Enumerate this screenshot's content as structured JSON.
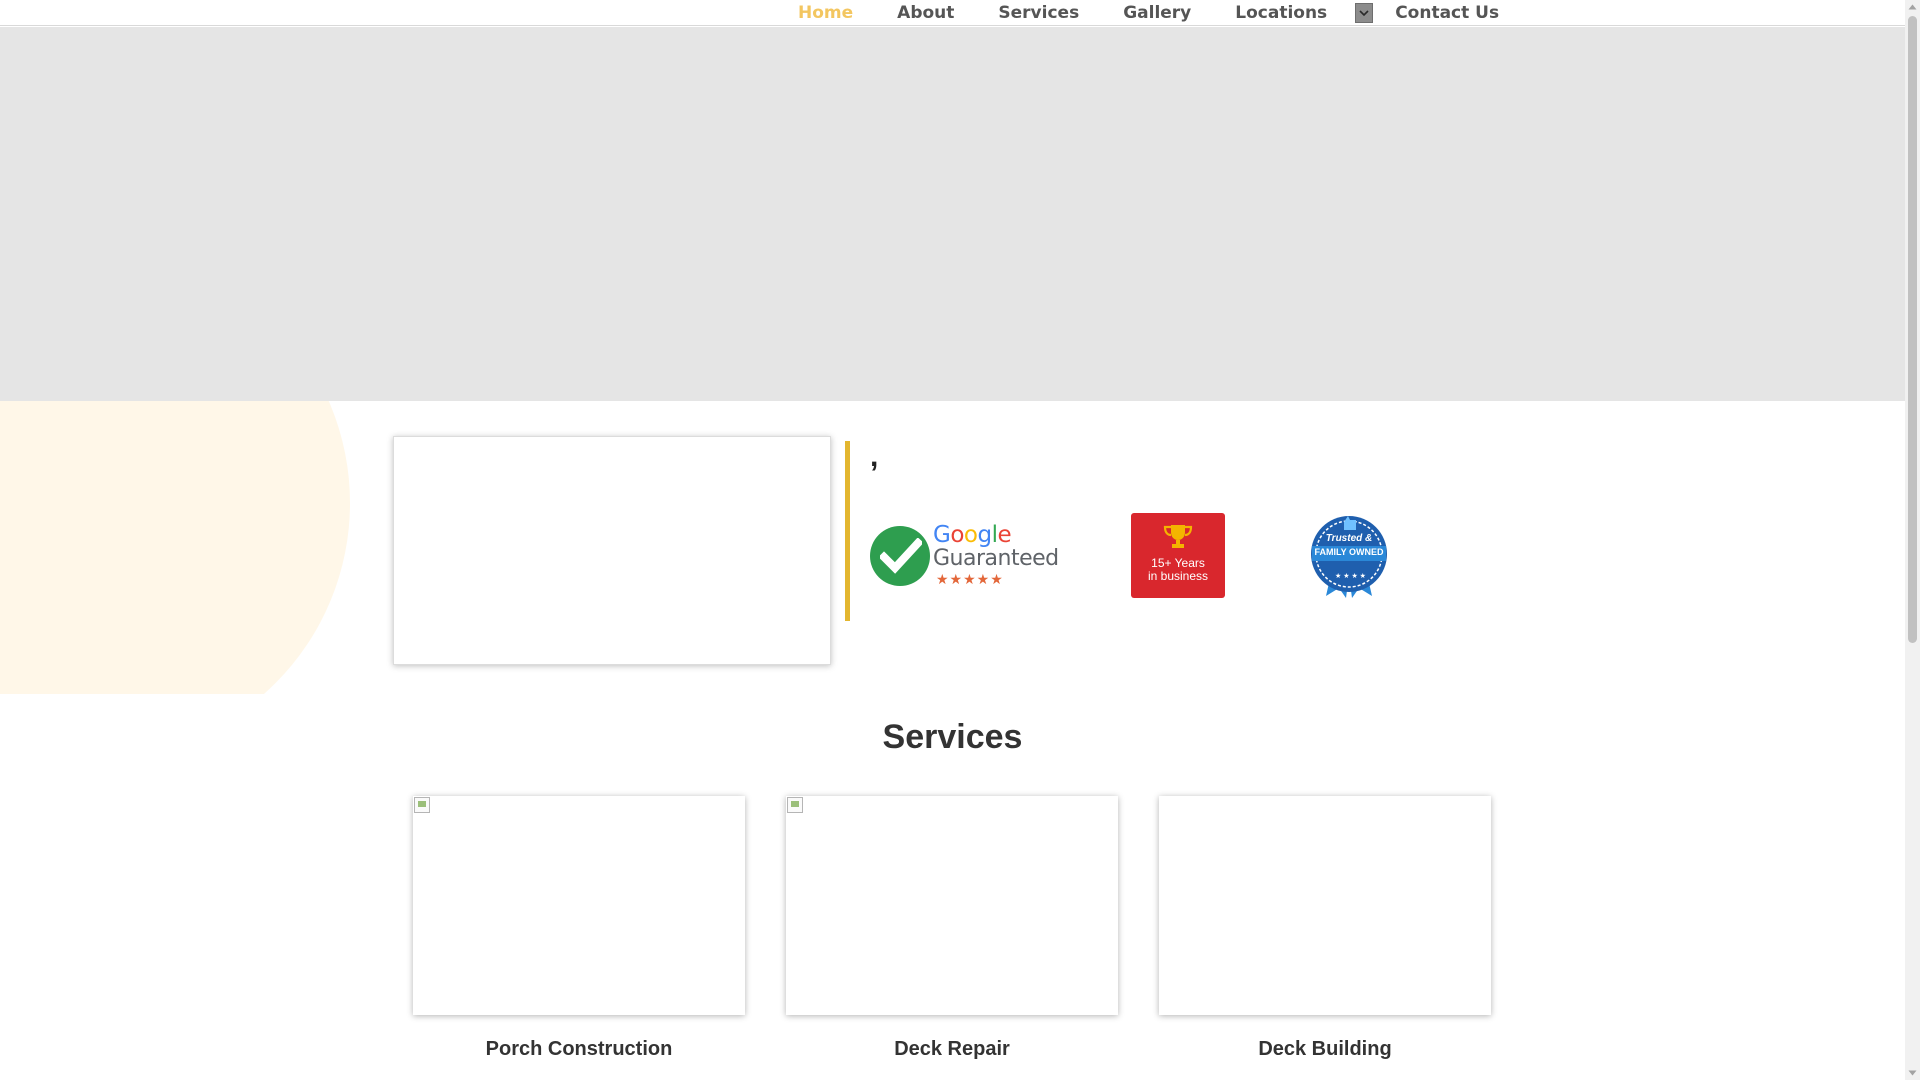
{
  "nav": {
    "items": [
      {
        "label": "Home",
        "active": true
      },
      {
        "label": "About",
        "active": false
      },
      {
        "label": "Services",
        "active": false
      },
      {
        "label": "Gallery",
        "active": false
      },
      {
        "label": "Locations",
        "active": false
      },
      {
        "label": "Contact Us",
        "active": false
      }
    ],
    "dropdown_icon": "chevron-down-icon"
  },
  "intro": {
    "comma": ","
  },
  "badges": {
    "google": {
      "word": [
        "G",
        "o",
        "o",
        "g",
        "l",
        "e"
      ],
      "word_colors": [
        "#4285f4",
        "#ea4335",
        "#fbbc05",
        "#4285f4",
        "#34a853",
        "#ea4335"
      ],
      "subtitle": "Guaranteed",
      "stars": "★★★★★"
    },
    "years": {
      "line1": "15+ Years",
      "line2": "in business"
    },
    "trusted": {
      "line1": "Trusted &",
      "line2": "FAMILY OWNED"
    }
  },
  "services": {
    "title": "Services",
    "items": [
      {
        "name": "Porch Construction",
        "broken_image": true
      },
      {
        "name": "Deck Repair",
        "broken_image": true
      },
      {
        "name": "Deck Building",
        "broken_image": false
      }
    ]
  },
  "colors": {
    "accent": "#f3c660",
    "nav_text": "#555555",
    "hero_bg": "#e5e5e5",
    "bar": "#e3b62f",
    "badge_red": "#d9272d",
    "badge_blue": "#1f5fae"
  }
}
